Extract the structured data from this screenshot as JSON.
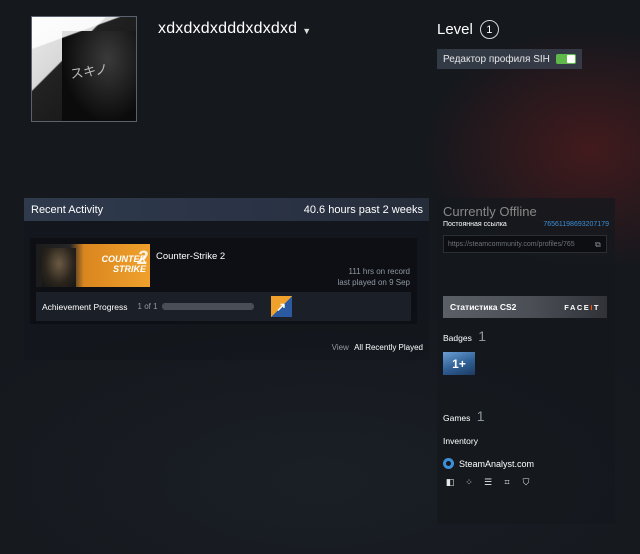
{
  "profile": {
    "persona_name": "xdxdxdxdddxdxdxd",
    "level_label": "Level",
    "level_value": "1",
    "sih_toggle_label": "Редактор профиля SIH",
    "sih_toggle_on": true,
    "avatar_text": "スキノ"
  },
  "recent_activity": {
    "title": "Recent Activity",
    "summary": "40.6 hours past 2 weeks",
    "game": {
      "name": "Counter-Strike 2",
      "capsule_text_top": "COUNTER",
      "capsule_text_bottom": "STRIKE",
      "capsule_numeral": "2",
      "hours_on_record": "111 hrs on record",
      "last_played": "last played on 9 Sep"
    },
    "achievement": {
      "label": "Achievement Progress",
      "count": "1 of 1",
      "progress": 1.0
    },
    "view_label": "View",
    "view_link": "All Recently Played"
  },
  "sidebar": {
    "status": "Currently Offline",
    "perm_link_label": "Постоянная ссылка",
    "steam_id": "76561198693207179",
    "perm_link_url": "https://steamcommunity.com/profiles/765",
    "cs2_stats_label": "Статистика CS2",
    "faceit_pre": "FACE",
    "faceit_x": "I",
    "faceit_post": "T",
    "badges_label": "Badges",
    "badges_count": "1",
    "badge_1plus": "1+",
    "games_label": "Games",
    "games_count": "1",
    "inventory_label": "Inventory",
    "steamanalyst_label": "SteamAnalyst.com",
    "tool_icons": [
      "card-icon",
      "dots-icon",
      "list-icon",
      "bracket-icon",
      "shield-icon"
    ]
  },
  "colors": {
    "accent_blue": "#3d8fd6",
    "toggle_green": "#5fb94a",
    "faceit_orange": "#ff5500",
    "cs2_orange": "#f0a12c"
  }
}
